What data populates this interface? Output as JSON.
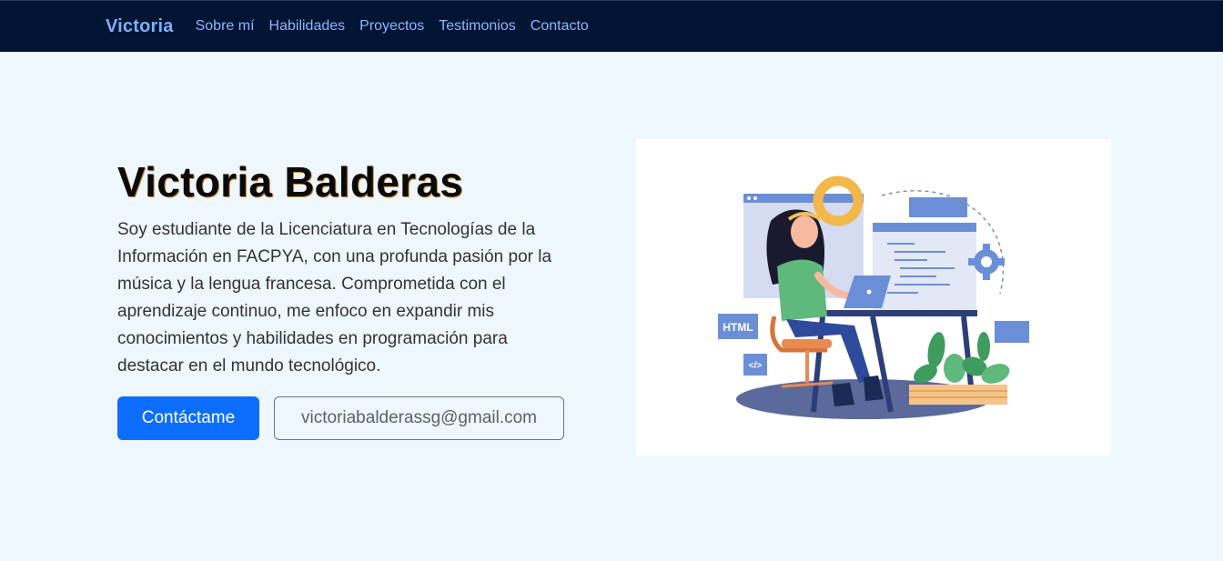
{
  "navbar": {
    "brand": "Victoria",
    "links": [
      "Sobre mí",
      "Habilidades",
      "Proyectos",
      "Testimonios",
      "Contacto"
    ]
  },
  "hero": {
    "title": "Victoria Balderas",
    "description": "Soy estudiante de la Licenciatura en Tecnologías de la Información en FACPYA, con una profunda pasión por la música y la lengua francesa. Comprometida con el aprendizaje continuo, me enfoco en expandir mis conocimientos y habilidades en programación para destacar en el mundo tecnológico.",
    "contact_button": "Contáctame",
    "email_button": "victoriabalderassg@gmail.com"
  },
  "illustration": {
    "html_badge": "HTML",
    "code_badge": "</>"
  },
  "colors": {
    "navbar_bg": "#001433",
    "page_bg": "#eef6fe",
    "primary": "#0d6efd",
    "brand": "#7eb0ff"
  }
}
